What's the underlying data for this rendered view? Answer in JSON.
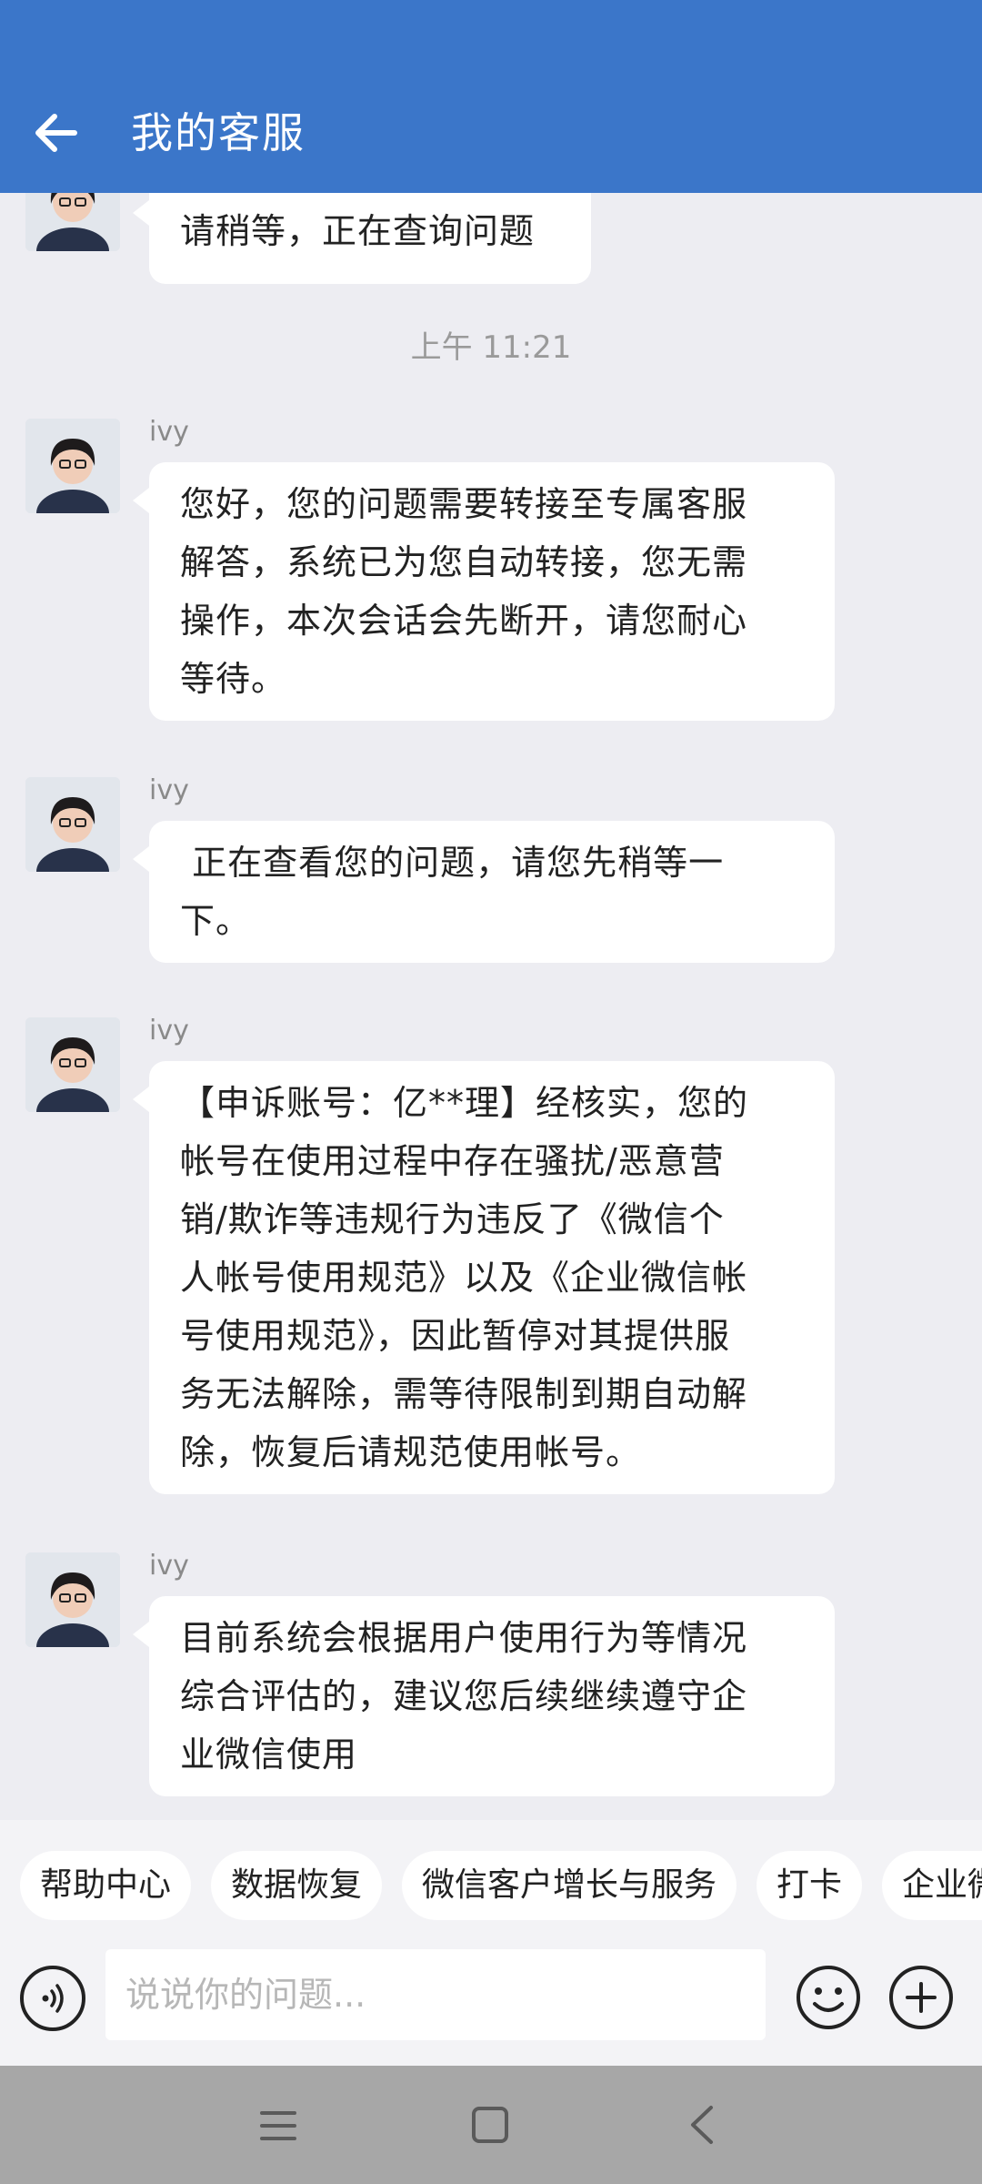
{
  "header": {
    "title": "我的客服",
    "back_icon": "arrow-left-icon"
  },
  "chat": {
    "first_partial": "请稍等，正在查询问题",
    "timestamp": "上午 11:21",
    "messages": [
      {
        "sender": "ivy",
        "lines": [
          "您好，您的问题需要转接至专属客服",
          "解答，系统已为您自动转接，您无需",
          "操作，本次会话会先断开，请您耐心",
          "等待。"
        ]
      },
      {
        "sender": "ivy",
        "lines": [
          " 正在查看您的问题，请您先稍等一",
          "下。"
        ]
      },
      {
        "sender": "ivy",
        "lines": [
          "【申诉账号：亿**理】经核实，您的",
          "帐号在使用过程中存在骚扰/恶意营",
          "销/欺诈等违规行为违反了《微信个",
          "人帐号使用规范》以及《企业微信帐",
          "号使用规范》，因此暂停对其提供服",
          "务无法解除，需等待限制到期自动解",
          "除，恢复后请规范使用帐号。"
        ]
      },
      {
        "sender": "ivy",
        "lines": [
          "目前系统会根据用户使用行为等情况",
          "综合评估的，建议您后续继续遵守企",
          "业微信使用"
        ]
      }
    ]
  },
  "quick_chips": [
    "帮助中心",
    "数据恢复",
    "微信客户增长与服务",
    "打卡",
    "企业微"
  ],
  "input": {
    "placeholder": "说说你的问题..."
  },
  "colors": {
    "header_bg": "#3b76c9",
    "chat_bg": "#ededf2",
    "bubble_bg": "#ffffff",
    "nav_bg": "#a7a7a7"
  }
}
